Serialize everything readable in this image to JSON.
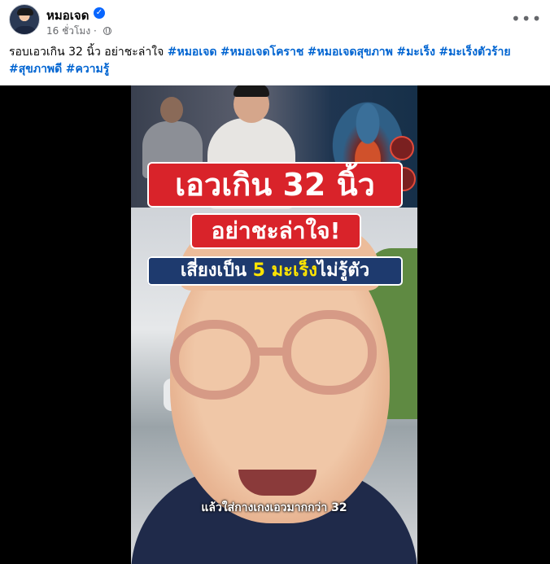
{
  "post": {
    "author": "หมอเจด",
    "verified": true,
    "time": "16 ชั่วโมง",
    "separator": "·",
    "privacy_icon": "globe-icon",
    "more_label": "•••",
    "caption_text": "รอบเอวเกิน 32 นิ้ว อย่าชะล่าใจ",
    "hashtags": [
      "#หมอเจด",
      "#หมอเจดโคราช",
      "#หมอเจดสุขภาพ",
      "#มะเร็ง",
      "#มะเร็งตัวร้าย",
      "#สุขภาพดี",
      "#ความรู้"
    ]
  },
  "video": {
    "headline1": "เอวเกิน 32 นิ้ว",
    "headline2": "อย่าชะล่าใจ!",
    "headline3_prefix": "เสี่ยงเป็น ",
    "headline3_highlight": "5 มะเร็ง",
    "headline3_suffix": "ไม่รู้ตัว",
    "subtitle": "แล้วใส่กางเกงเอวมากกว่า 32"
  },
  "colors": {
    "link": "#0064d1",
    "headline_red": "#d9232a",
    "headline_navy": "#1e3a6e",
    "highlight_yellow": "#ffe500",
    "verified_blue": "#0866ff"
  }
}
